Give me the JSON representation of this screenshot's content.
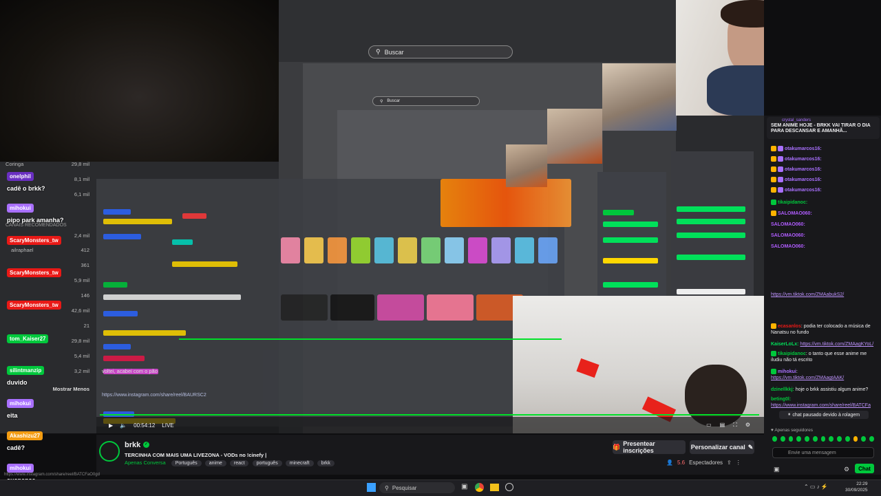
{
  "stream": {
    "search_placeholder": "Buscar",
    "search_placeholder_small": "Buscar",
    "time": "00:54:12",
    "live_label": "LIVE"
  },
  "left_overlay": {
    "recommended_label": "CANAIS RECOMENDADOS",
    "show_less": "Mostrar Menos",
    "rows": [
      {
        "name": "Coringa",
        "count": "29,8 mil"
      },
      {
        "name": "",
        "count": "8,1 mil"
      },
      {
        "name": "",
        "count": "6,1 mil"
      },
      {
        "name": "",
        "count": "2,4 mil"
      },
      {
        "name": "ailraphael",
        "count": "412"
      },
      {
        "name": "",
        "count": "361"
      },
      {
        "name": "",
        "count": "5,9 mil"
      },
      {
        "name": "",
        "count": "146"
      },
      {
        "name": "",
        "count": "42,6 mil"
      },
      {
        "name": "",
        "count": "21"
      },
      {
        "name": "",
        "count": "29,8 mil"
      },
      {
        "name": "",
        "count": "5,4 mil"
      },
      {
        "name": "",
        "count": "3,2 mil"
      }
    ],
    "messages": [
      {
        "user": "onelphil",
        "text": "cadê o brkk?",
        "color": "#9147ff"
      },
      {
        "user": "mihokui",
        "text": "pipo park amanha?",
        "color": "#a970ff"
      },
      {
        "user": "ScaryMonsters_tw",
        "text": "",
        "color": "#e91916"
      },
      {
        "user": "ScaryMonsters_tw",
        "text": "",
        "color": "#e91916"
      },
      {
        "user": "ScaryMonsters_tw",
        "text": "",
        "color": "#e91916"
      },
      {
        "user": "tom_Kaiser27",
        "text": "",
        "color": "#00c83c"
      },
      {
        "user": "silintmanzip",
        "text": "duvido",
        "color": "#00c83c"
      },
      {
        "user": "mihokui",
        "text": "eita",
        "color": "#a970ff"
      },
      {
        "user": "Akashizu27",
        "text": "cadê?",
        "color": "#f39c12"
      },
      {
        "user": "mihokui",
        "text": "suspense",
        "color": "#a970ff"
      }
    ],
    "inner_msg": "voltei, acabei com o pão",
    "inner_link": "https://www.instagram.com/share/reel/BAURSC2"
  },
  "channel": {
    "name": "brkk",
    "title": "TERCINHA COM MAIS UMA LIVEZONA - VODs no !cinefy |",
    "category": "Apenas Conversa",
    "tags": [
      "Português",
      "anime",
      "react",
      "português",
      "minecraft",
      "brkk"
    ],
    "present_button": "Presentear inscrições",
    "customize_button": "Personalizar canal",
    "viewers_label": "Espectadores",
    "viewers": "5.6",
    "footer_link": "https://www.instagram.com/share/reel/BATCFaO0gd"
  },
  "chat": {
    "pinned": "SEM ANIME HOJE - BRKK VAI TIRAR O DIA PARA DESCANSAR E AMANHÃ...",
    "pinned_user": "crystal_sanders",
    "messages": [
      {
        "user": "otakumarcos16:",
        "text": "",
        "color": "#a970ff"
      },
      {
        "user": "otakumarcos16:",
        "text": "",
        "color": "#a970ff"
      },
      {
        "user": "otakumarcos16:",
        "text": "",
        "color": "#a970ff"
      },
      {
        "user": "otakumarcos16:",
        "text": "",
        "color": "#a970ff"
      },
      {
        "user": "otakumarcos16:",
        "text": "",
        "color": "#a970ff"
      },
      {
        "user": "tikaipidanoc:",
        "text": "",
        "color": "#00c83c"
      },
      {
        "user": "SALOMAO060:",
        "text": "",
        "color": "#b05cff"
      },
      {
        "user": "SALOMAO060:",
        "text": "",
        "color": "#b05cff"
      },
      {
        "user": "SALOMAO060:",
        "text": "",
        "color": "#b05cff"
      },
      {
        "user": "SALOMAO060:",
        "text": "",
        "color": "#b05cff"
      }
    ],
    "link1": "https://vm.tiktok.com/ZMAabukS2/",
    "msg_a_user": "ecasanlos",
    "msg_a_text": "podia ter colocado a música de Nanatsu no fundo",
    "msg_b_user": "KaiserLoLx:",
    "msg_b_link": "https://vm.tiktok.com/ZMAagKYoL/",
    "msg_c_user": "tikaipidanoc",
    "msg_c_text": "o tanto que esse anime me iludiu não tá escrito",
    "msg_d_user": "mihokui",
    "msg_d_link": "https://vm.tiktok.com/ZMAagtAAK/",
    "msg_e_user": "dzinellkkj:",
    "msg_e_text": "hoje o brkk assistiu algum anime?",
    "msg_f_user": "beting0l:",
    "msg_f_link": "https://www.instagram.com/share/reel/BATCFa",
    "paused": "chat pausado devido à rolagem",
    "followers_only": "Apenas seguidores",
    "input_placeholder": "Envie uma mensagem",
    "chat_button": "Chat"
  },
  "taskbar": {
    "search_placeholder": "Pesquisar",
    "time": "22:29",
    "date": "30/09/2025"
  }
}
